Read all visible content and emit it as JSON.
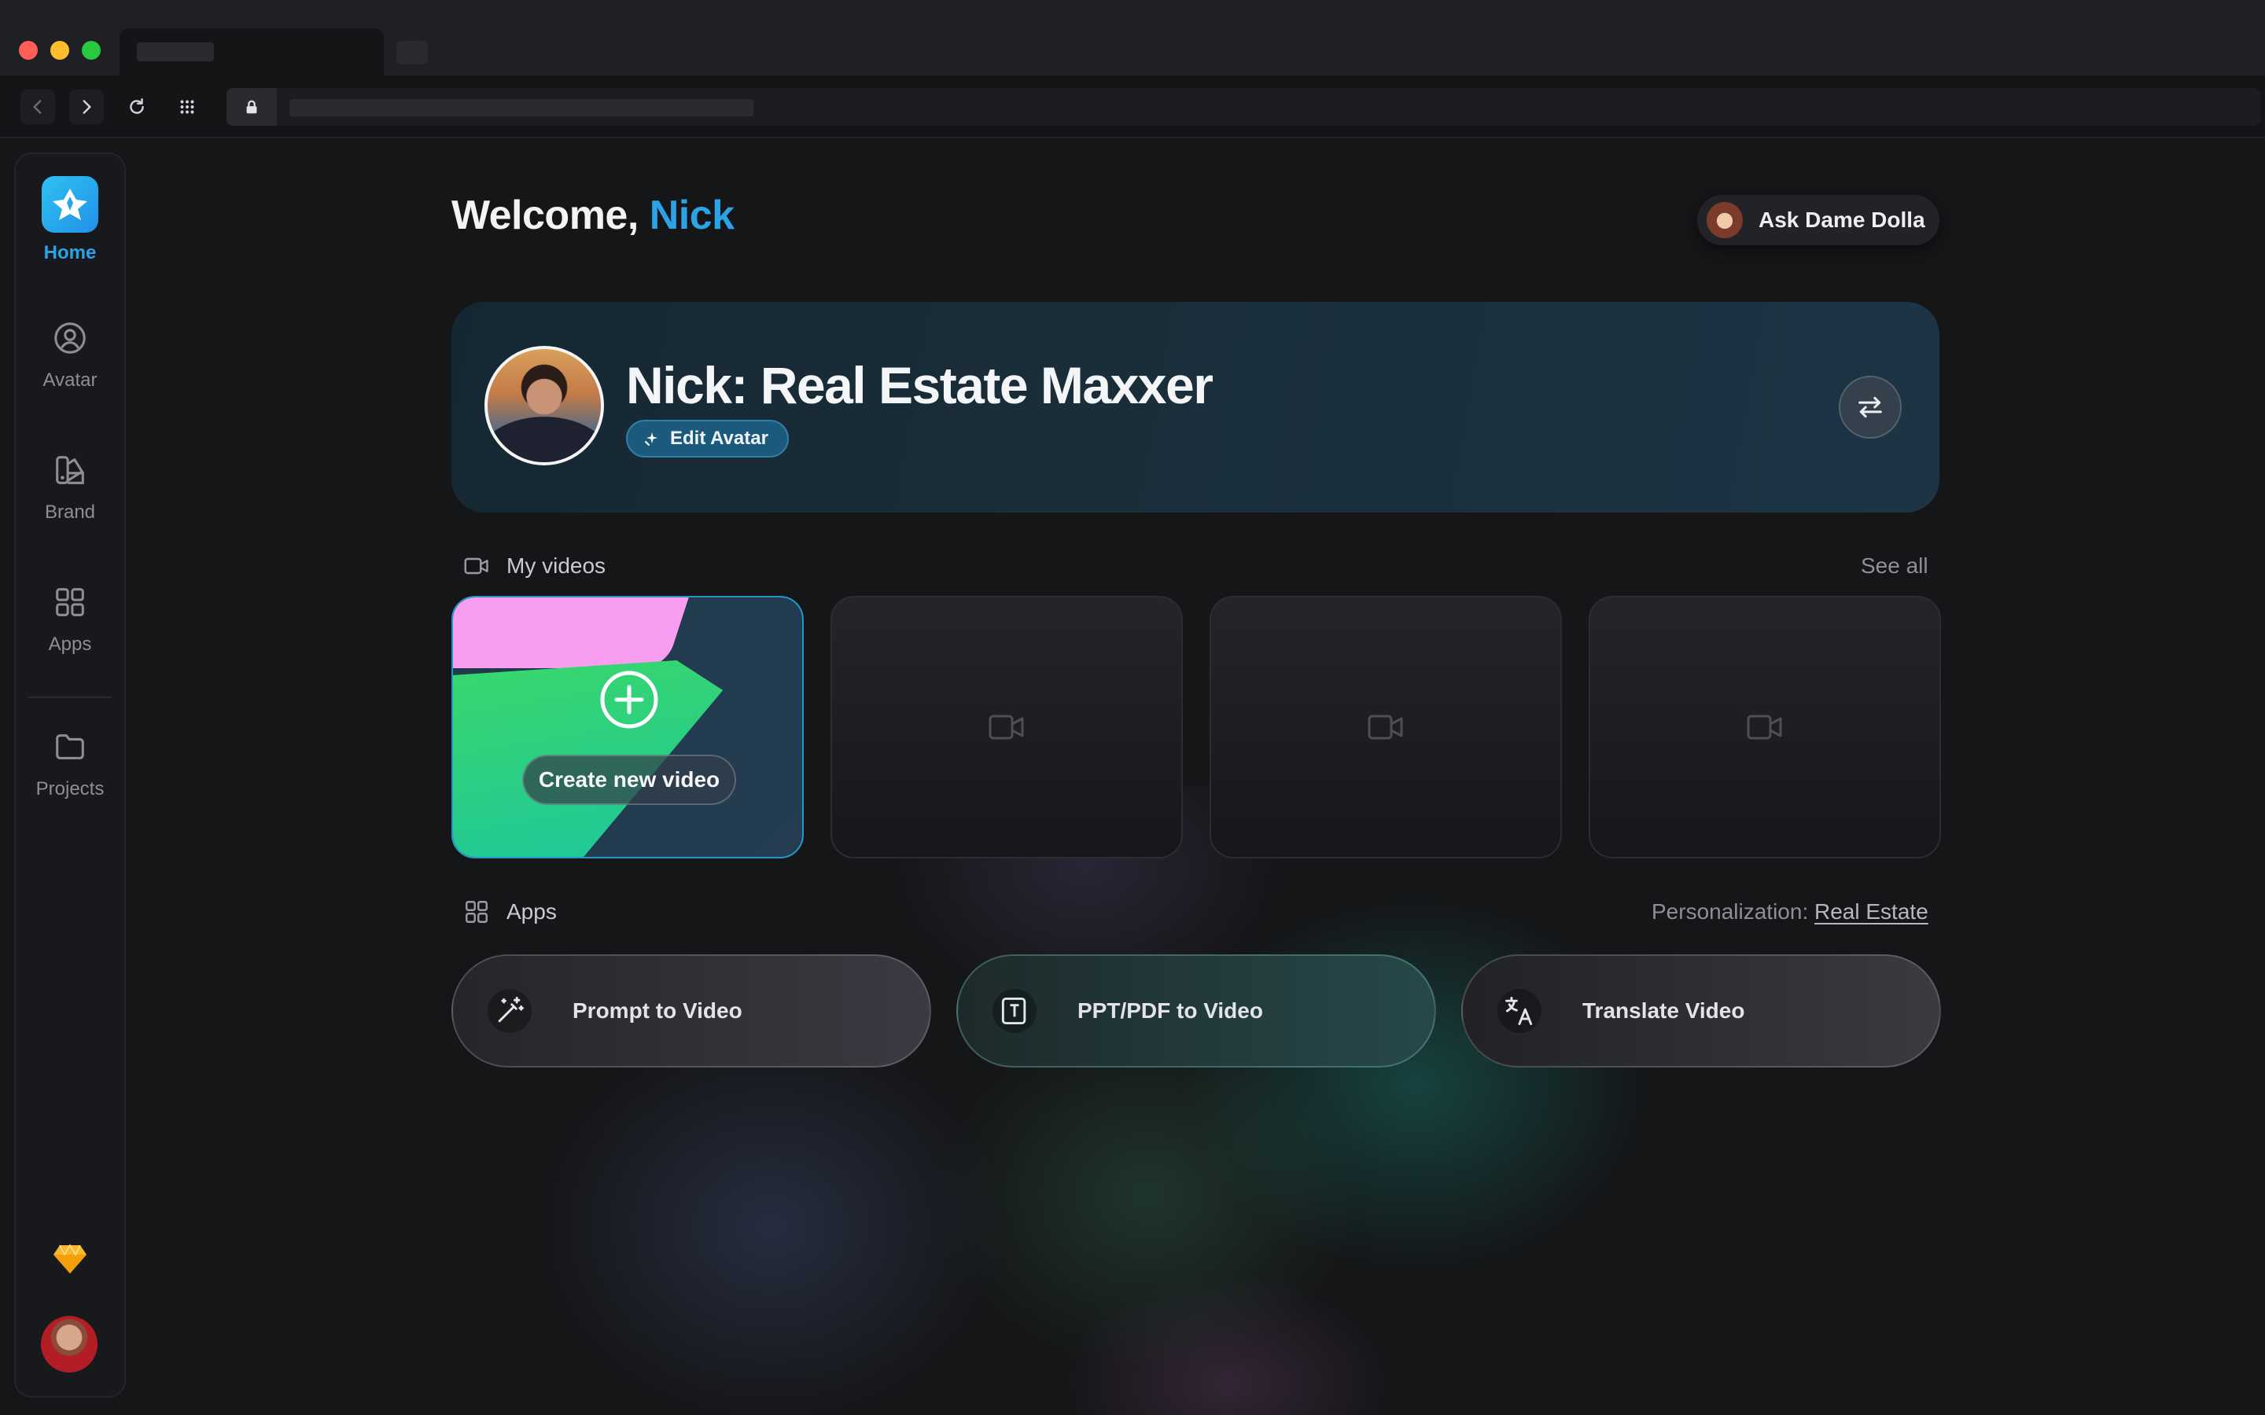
{
  "sidebar": {
    "items": [
      {
        "label": "Home"
      },
      {
        "label": "Avatar"
      },
      {
        "label": "Brand"
      },
      {
        "label": "Apps"
      },
      {
        "label": "Projects"
      }
    ]
  },
  "header": {
    "welcome_prefix": "Welcome,",
    "user_name": "Nick",
    "ask_button_label": "Ask Dame Dolla"
  },
  "avatar_card": {
    "title": "Nick: Real Estate Maxxer",
    "edit_label": "Edit Avatar"
  },
  "my_videos": {
    "heading": "My videos",
    "see_all": "See all",
    "create_label": "Create new video"
  },
  "apps": {
    "heading": "Apps",
    "personalization_label": "Personalization:",
    "personalization_value": "Real Estate",
    "items": [
      {
        "label": "Prompt to Video",
        "icon": "magic-wand-icon"
      },
      {
        "label": "PPT/PDF to Video",
        "icon": "document-text-icon"
      },
      {
        "label": "Translate Video",
        "icon": "translate-icon"
      }
    ]
  },
  "colors": {
    "accent": "#2aa4e6",
    "background": "#151618"
  }
}
